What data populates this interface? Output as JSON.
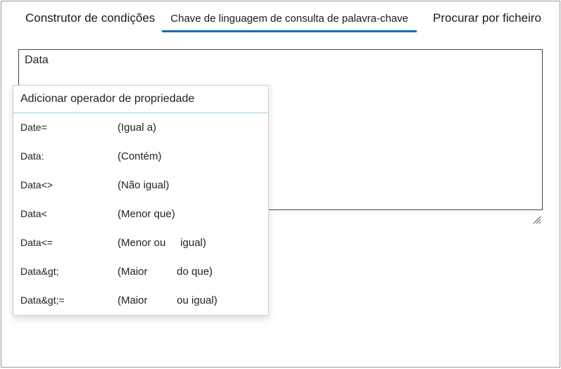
{
  "tabs": {
    "left": "Construtor de condições",
    "middle": "Chave de linguagem de consulta de palavra-chave",
    "right": "Procurar por ficheiro"
  },
  "query": {
    "value": "Data"
  },
  "dropdown": {
    "header": "Adicionar operador de propriedade",
    "items": [
      {
        "key": "Date=",
        "desc": "(Igual a)"
      },
      {
        "key": "Data:",
        "desc": "(Contém)"
      },
      {
        "key": "Data<>",
        "desc": "(Não igual)"
      },
      {
        "key": "Data<",
        "desc": "(Menor que)"
      },
      {
        "key": "Data<=",
        "desc": "(Menor ou     igual)"
      },
      {
        "key": "Data&gt;",
        "desc": "(Maior          do que)"
      },
      {
        "key": "Data&gt;=",
        "desc": "(Maior          ou igual)"
      }
    ]
  }
}
